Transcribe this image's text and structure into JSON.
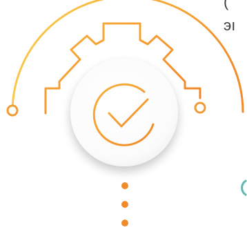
{
  "text": {
    "line1": "(",
    "line2": "эı"
  },
  "icons": {
    "gear": "gear-icon",
    "check": "checkmark-icon"
  },
  "colors": {
    "arc_light": "#f7c94b",
    "arc_dark": "#f08a2a",
    "gear_stroke": "#f29a33",
    "dot": "#f08a2a",
    "teal_hint": "#5fb7b0"
  }
}
